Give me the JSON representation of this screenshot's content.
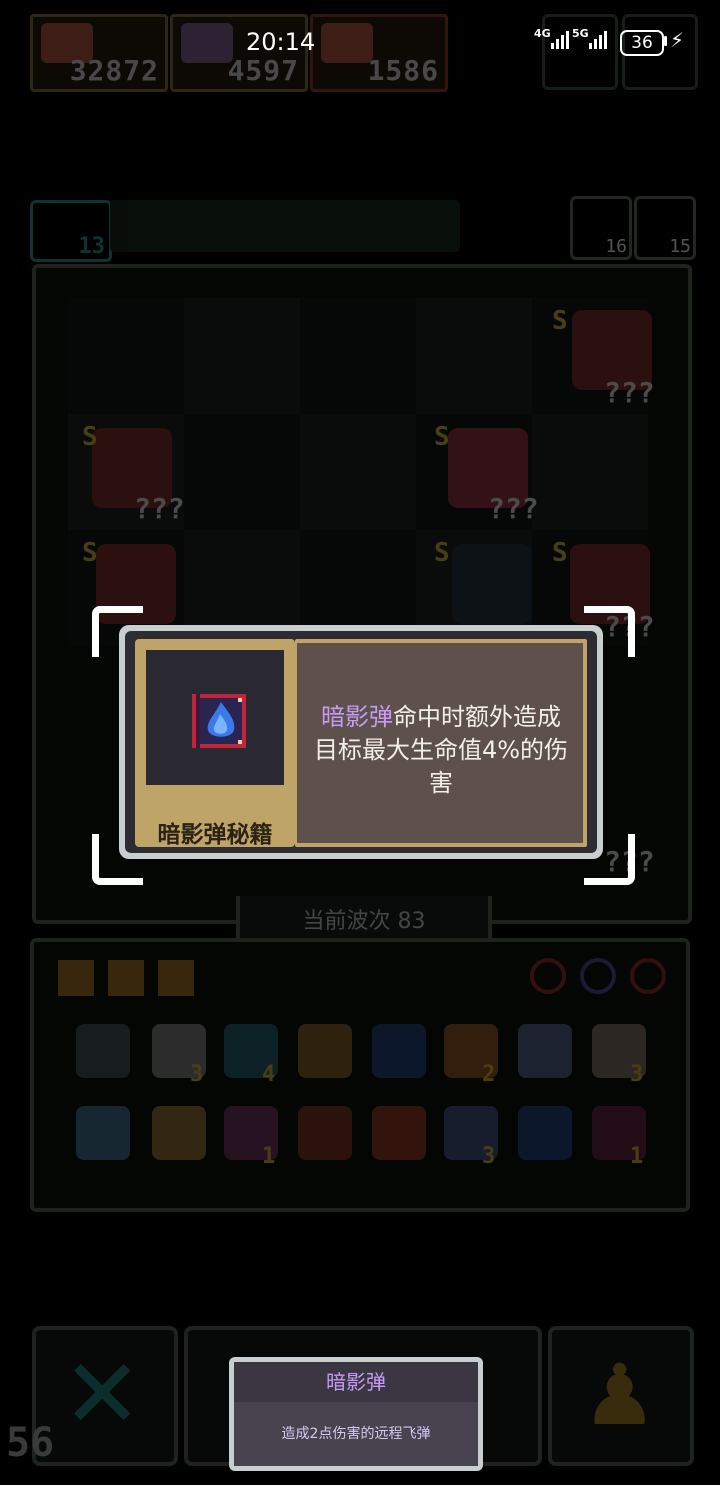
{
  "status_bar": {
    "time": "20:14",
    "network_1": "4G",
    "network_2": "5G",
    "battery": "36"
  },
  "resources": [
    {
      "name": "general-portrait-icon",
      "value": "32872"
    },
    {
      "name": "hammer-icon",
      "value": "4597"
    },
    {
      "name": "general-portrait-icon",
      "value": "1586"
    }
  ],
  "top_row": {
    "level_badge": "13",
    "counter_a": "16",
    "counter_b": "15"
  },
  "board": {
    "grade_label": "S",
    "unknown_label": "???"
  },
  "wave_label": "当前波次 83",
  "item_counts": {
    "scroll": "3",
    "heart": "4",
    "axe": "2",
    "book": "3",
    "potion": "1",
    "hourglass": "3",
    "orb": "1"
  },
  "popup": {
    "item_name": "暗影弹秘籍",
    "desc_highlight": "暗影弹",
    "desc_rest": "命中时额外造成目标最大生命值4%的伤害",
    "accent_color": "#c99af5"
  },
  "toast": {
    "title": "暗影弹",
    "body": "造成2点伤害的远程飞弹"
  },
  "corner_number": "56"
}
